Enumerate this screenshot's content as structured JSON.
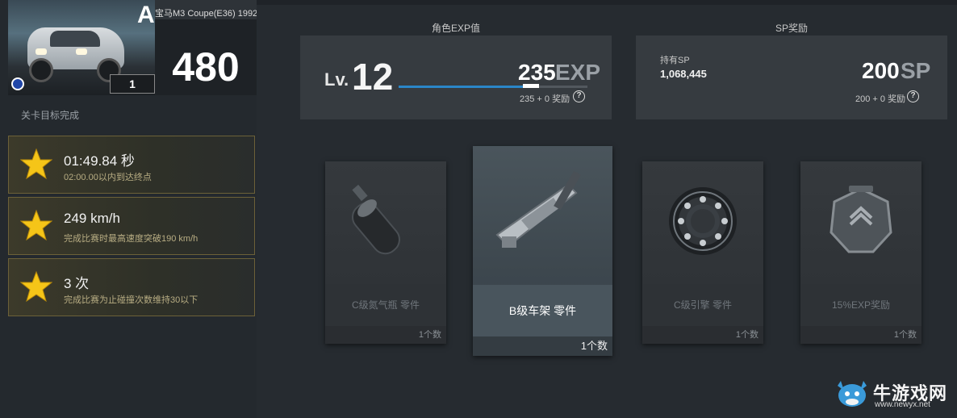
{
  "car": {
    "class": "A",
    "name": "宝马M3 Coupe(E36) 1992",
    "pi": "480",
    "rank": "1"
  },
  "goals": {
    "title": "关卡目标完成",
    "items": [
      {
        "main": "01:49.84 秒",
        "sub": "02:00.00以内到达终点"
      },
      {
        "main": "249 km/h",
        "sub": "完成比赛时最高速度突破190 km/h"
      },
      {
        "main": "3 次",
        "sub": "完成比赛为止碰撞次数维持30以下"
      }
    ]
  },
  "exp": {
    "title": "角色EXP值",
    "lv_label": "Lv.",
    "level": "12",
    "value": "235",
    "unit": "EXP",
    "progress": 0.66,
    "detail": "235 + 0 奖励"
  },
  "sp": {
    "title": "SP奖励",
    "held_label": "持有SP",
    "held_value": "1,068,445",
    "value": "200",
    "unit": "SP",
    "detail": "200 + 0 奖励"
  },
  "rewards": [
    {
      "name": "C级氮气瓶 零件",
      "qty": "1个数",
      "icon": "nitro-bottle-icon",
      "selected": false
    },
    {
      "name": "B级车架 零件",
      "qty": "1个数",
      "icon": "chassis-frame-icon",
      "selected": true
    },
    {
      "name": "C级引擎 零件",
      "qty": "1个数",
      "icon": "bearing-icon",
      "selected": false
    },
    {
      "name": "15%EXP奖励",
      "qty": "1个数",
      "icon": "exp-badge-icon",
      "selected": false
    }
  ],
  "help_symbol": "?",
  "watermark": {
    "text": "牛游戏网",
    "url": "www.newyx.net"
  },
  "colors": {
    "accent": "#2a86c8",
    "goal_border": "#6c6138",
    "star": "#f5c518"
  }
}
